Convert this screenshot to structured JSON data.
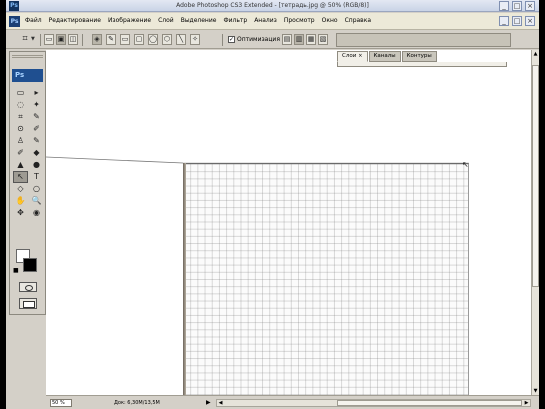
{
  "app": {
    "title": "Adobe Photoshop CS3 Extended - [тетрадь.jpg @ 50% (RGB/8)]",
    "icon": "Ps"
  },
  "window_controls": {
    "minimize": "_",
    "maximize": "□",
    "close": "×"
  },
  "menu": {
    "items": [
      "Файл",
      "Редактирование",
      "Изображение",
      "Слой",
      "Выделение",
      "Фильтр",
      "Анализ",
      "Просмотр",
      "Окно",
      "Справка"
    ]
  },
  "options_bar": {
    "current_tool_icon": "crop-tool-icon",
    "antialias_label": "Оптимизация",
    "antialias_checked": true
  },
  "panels": {
    "tabs": [
      "Слои",
      "Каналы",
      "Контуры"
    ],
    "active_tab": "Слои"
  },
  "toolbox": {
    "logo": "Ps",
    "tools": [
      "▭",
      "▸",
      "◌",
      "✦",
      "⌗",
      "✎",
      "⊙",
      "✐",
      "♙",
      "✎",
      "✐",
      "◆",
      "▲",
      "●",
      "↖",
      "T",
      "◇",
      "○",
      "✋",
      "🔍",
      "✥",
      "◉",
      "◍",
      "⊕"
    ],
    "foreground_color": "#000000",
    "background_color": "#ffffff"
  },
  "status": {
    "zoom": "50 %",
    "doc_info": "Док: 6,30M/13,5M",
    "arrow": "▶"
  },
  "colors": {
    "chrome": "#d4d0c8",
    "title_bar": "#c9d3e6",
    "workspace": "#ffffff",
    "grid_paper": "#fbfbfb"
  }
}
